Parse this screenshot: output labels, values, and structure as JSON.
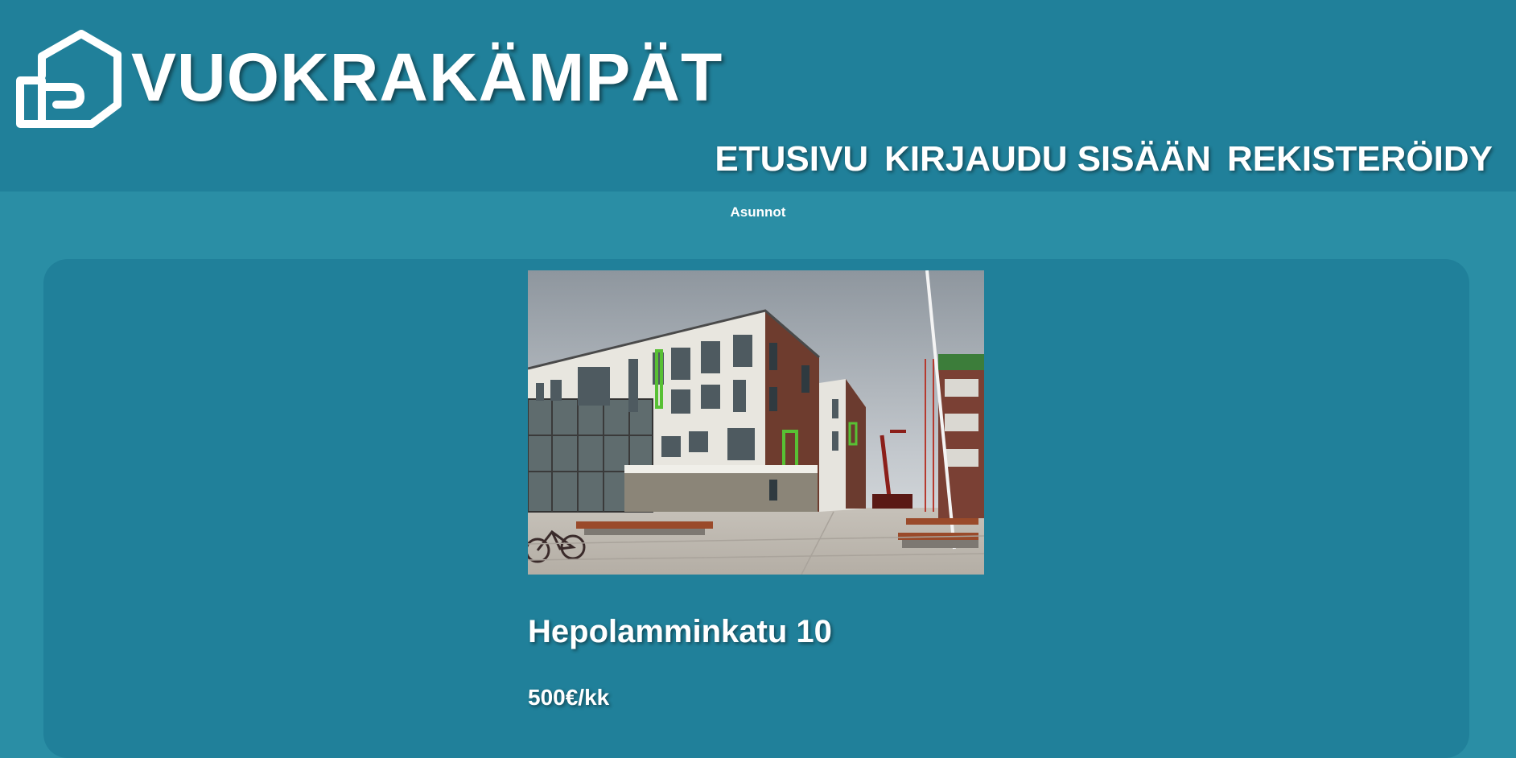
{
  "header": {
    "site_title": "VUOKRAKÄMPÄT",
    "logo_icon": "house-on-hand-icon",
    "nav": [
      {
        "label": "ETUSIVU"
      },
      {
        "label": "KIRJAUDU SISÄÄN"
      },
      {
        "label": "REKISTERÖIDY"
      }
    ]
  },
  "subnav": {
    "label": "Asunnot"
  },
  "listing": {
    "image_subject": "apartment-building-photo",
    "title": "Hepolamminkatu 10",
    "price": "500€/kk"
  },
  "colors": {
    "page_background": "#2a8ea5",
    "header_background": "#20809a",
    "card_background": "#20809a",
    "text": "#ffffff"
  }
}
